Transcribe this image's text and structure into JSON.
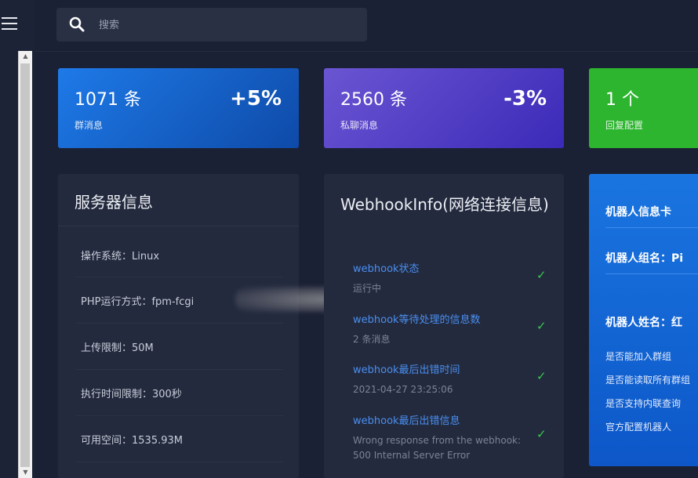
{
  "search": {
    "placeholder": "搜索"
  },
  "stats": [
    {
      "value": "1071 条",
      "change": "+5%",
      "label": "群消息",
      "color": "#1a6ad6"
    },
    {
      "value": "2560 条",
      "change": "-3%",
      "label": "私聊消息",
      "color": "#5040c8"
    },
    {
      "value": "1 个",
      "change": "",
      "label": "回复配置",
      "color": "#2db52f"
    }
  ],
  "server": {
    "title": "服务器信息",
    "rows": [
      "操作系统：Linux",
      "PHP运行方式：fpm-fcgi",
      "上传限制：50M",
      "执行时间限制：300秒",
      "可用空间：1535.93M"
    ]
  },
  "webhook": {
    "title": "WebhookInfo(网络连接信息)",
    "items": [
      {
        "label": "webhook状态",
        "value": "运行中"
      },
      {
        "label": "webhook等待处理的信息数",
        "value": "2 条消息"
      },
      {
        "label": "webhook最后出错时间",
        "value": "2021-04-27 23:25:06"
      },
      {
        "label": "webhook最后出错信息",
        "value": "Wrong response from the webhook: 500 Internal Server Error"
      }
    ]
  },
  "robot": {
    "title": "机器人信息卡",
    "group_name": "机器人组名：Pi",
    "bot_name": "机器人姓名：红",
    "options": [
      "是否能加入群组",
      "是否能读取所有群组",
      "是否支持内联查询",
      "官方配置机器人"
    ]
  },
  "icons": {
    "menu": "hamburger-menu-icon",
    "search": "search-icon",
    "check": "check-icon"
  }
}
